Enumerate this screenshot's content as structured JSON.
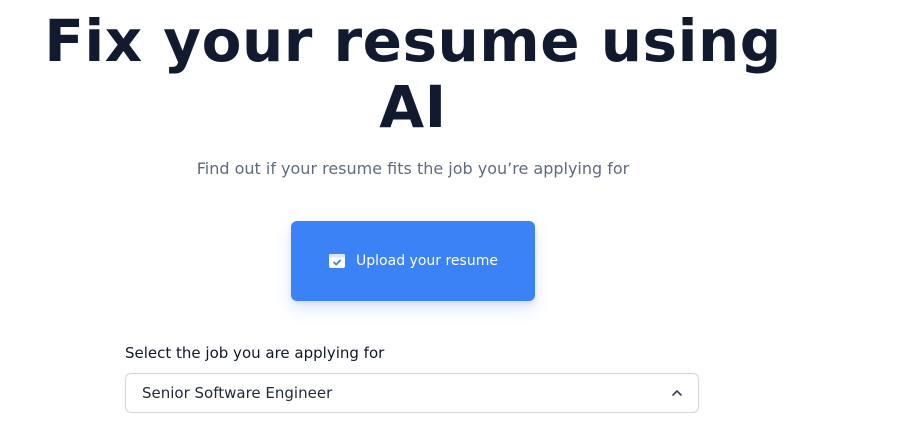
{
  "hero": {
    "title_line1": "Fix your resume using",
    "title_line2": "AI",
    "subtitle": "Find out if your resume fits the job you’re applying for"
  },
  "upload": {
    "label": "Upload your resume",
    "icon": "file-upload-icon",
    "color": "#3b82f6"
  },
  "job": {
    "label": "Select the job you are applying for",
    "selected": "Senior Software Engineer",
    "icon": "chevron-up-icon"
  }
}
